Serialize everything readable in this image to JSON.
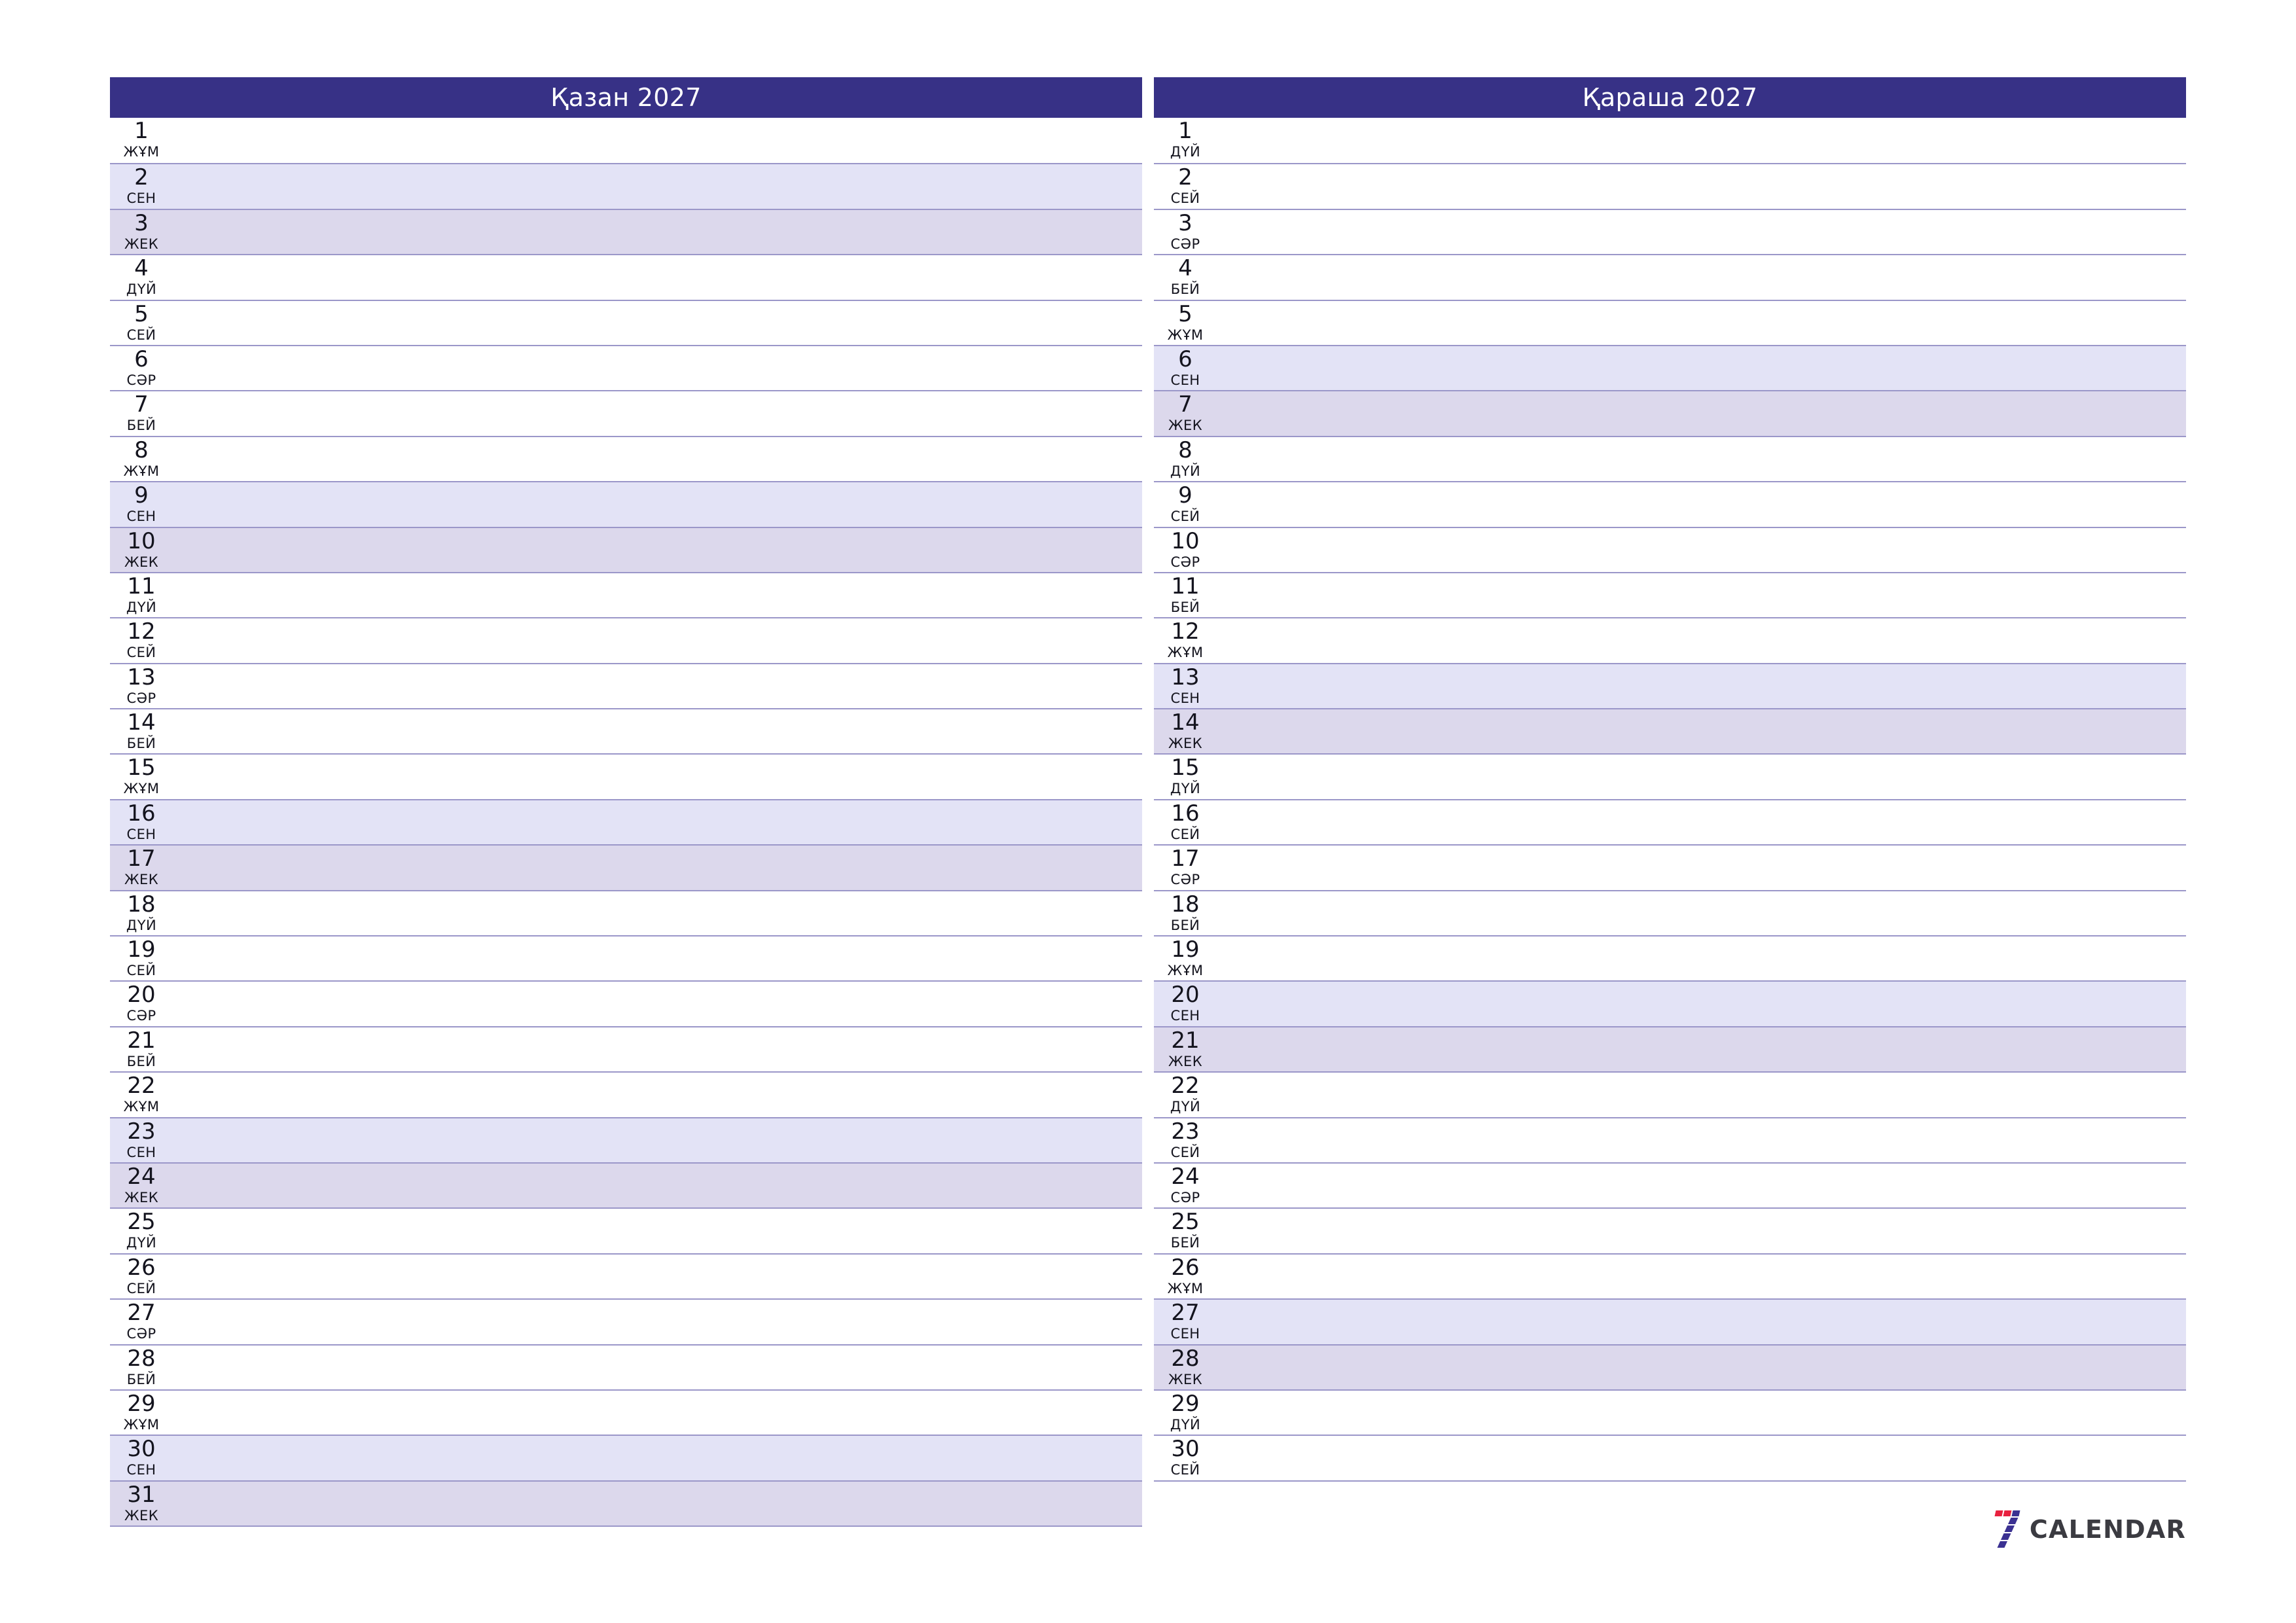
{
  "document": {
    "type": "monthly-planner",
    "year": "2027",
    "orientation": "landscape"
  },
  "colors": {
    "header_bg": "#373186",
    "header_text": "#ffffff",
    "saturday_bg": "#e3e3f6",
    "sunday_bg": "#dcd8ec",
    "grid_line": "#9b97c9",
    "day_text": "#14141e",
    "logo_red": "#e8213f",
    "logo_navy": "#3b3192",
    "logo_text": "#3b3b41"
  },
  "weekday_abbr": {
    "mon": "ДҮЙ",
    "tue": "СЕЙ",
    "wed": "СӘР",
    "thu": "БЕЙ",
    "fri": "ЖҰМ",
    "sat": "СЕН",
    "sun": "ЖЕК"
  },
  "months": [
    {
      "id": "october",
      "title": "Қазан 2027",
      "days": [
        {
          "num": "1",
          "wd": "ЖҰМ",
          "type": "weekday"
        },
        {
          "num": "2",
          "wd": "СЕН",
          "type": "sat"
        },
        {
          "num": "3",
          "wd": "ЖЕК",
          "type": "sun"
        },
        {
          "num": "4",
          "wd": "ДҮЙ",
          "type": "weekday"
        },
        {
          "num": "5",
          "wd": "СЕЙ",
          "type": "weekday"
        },
        {
          "num": "6",
          "wd": "СӘР",
          "type": "weekday"
        },
        {
          "num": "7",
          "wd": "БЕЙ",
          "type": "weekday"
        },
        {
          "num": "8",
          "wd": "ЖҰМ",
          "type": "weekday"
        },
        {
          "num": "9",
          "wd": "СЕН",
          "type": "sat"
        },
        {
          "num": "10",
          "wd": "ЖЕК",
          "type": "sun"
        },
        {
          "num": "11",
          "wd": "ДҮЙ",
          "type": "weekday"
        },
        {
          "num": "12",
          "wd": "СЕЙ",
          "type": "weekday"
        },
        {
          "num": "13",
          "wd": "СӘР",
          "type": "weekday"
        },
        {
          "num": "14",
          "wd": "БЕЙ",
          "type": "weekday"
        },
        {
          "num": "15",
          "wd": "ЖҰМ",
          "type": "weekday"
        },
        {
          "num": "16",
          "wd": "СЕН",
          "type": "sat"
        },
        {
          "num": "17",
          "wd": "ЖЕК",
          "type": "sun"
        },
        {
          "num": "18",
          "wd": "ДҮЙ",
          "type": "weekday"
        },
        {
          "num": "19",
          "wd": "СЕЙ",
          "type": "weekday"
        },
        {
          "num": "20",
          "wd": "СӘР",
          "type": "weekday"
        },
        {
          "num": "21",
          "wd": "БЕЙ",
          "type": "weekday"
        },
        {
          "num": "22",
          "wd": "ЖҰМ",
          "type": "weekday"
        },
        {
          "num": "23",
          "wd": "СЕН",
          "type": "sat"
        },
        {
          "num": "24",
          "wd": "ЖЕК",
          "type": "sun"
        },
        {
          "num": "25",
          "wd": "ДҮЙ",
          "type": "weekday"
        },
        {
          "num": "26",
          "wd": "СЕЙ",
          "type": "weekday"
        },
        {
          "num": "27",
          "wd": "СӘР",
          "type": "weekday"
        },
        {
          "num": "28",
          "wd": "БЕЙ",
          "type": "weekday"
        },
        {
          "num": "29",
          "wd": "ЖҰМ",
          "type": "weekday"
        },
        {
          "num": "30",
          "wd": "СЕН",
          "type": "sat"
        },
        {
          "num": "31",
          "wd": "ЖЕК",
          "type": "sun"
        }
      ]
    },
    {
      "id": "november",
      "title": "Қараша 2027",
      "days": [
        {
          "num": "1",
          "wd": "ДҮЙ",
          "type": "weekday"
        },
        {
          "num": "2",
          "wd": "СЕЙ",
          "type": "weekday"
        },
        {
          "num": "3",
          "wd": "СӘР",
          "type": "weekday"
        },
        {
          "num": "4",
          "wd": "БЕЙ",
          "type": "weekday"
        },
        {
          "num": "5",
          "wd": "ЖҰМ",
          "type": "weekday"
        },
        {
          "num": "6",
          "wd": "СЕН",
          "type": "sat"
        },
        {
          "num": "7",
          "wd": "ЖЕК",
          "type": "sun"
        },
        {
          "num": "8",
          "wd": "ДҮЙ",
          "type": "weekday"
        },
        {
          "num": "9",
          "wd": "СЕЙ",
          "type": "weekday"
        },
        {
          "num": "10",
          "wd": "СӘР",
          "type": "weekday"
        },
        {
          "num": "11",
          "wd": "БЕЙ",
          "type": "weekday"
        },
        {
          "num": "12",
          "wd": "ЖҰМ",
          "type": "weekday"
        },
        {
          "num": "13",
          "wd": "СЕН",
          "type": "sat"
        },
        {
          "num": "14",
          "wd": "ЖЕК",
          "type": "sun"
        },
        {
          "num": "15",
          "wd": "ДҮЙ",
          "type": "weekday"
        },
        {
          "num": "16",
          "wd": "СЕЙ",
          "type": "weekday"
        },
        {
          "num": "17",
          "wd": "СӘР",
          "type": "weekday"
        },
        {
          "num": "18",
          "wd": "БЕЙ",
          "type": "weekday"
        },
        {
          "num": "19",
          "wd": "ЖҰМ",
          "type": "weekday"
        },
        {
          "num": "20",
          "wd": "СЕН",
          "type": "sat"
        },
        {
          "num": "21",
          "wd": "ЖЕК",
          "type": "sun"
        },
        {
          "num": "22",
          "wd": "ДҮЙ",
          "type": "weekday"
        },
        {
          "num": "23",
          "wd": "СЕЙ",
          "type": "weekday"
        },
        {
          "num": "24",
          "wd": "СӘР",
          "type": "weekday"
        },
        {
          "num": "25",
          "wd": "БЕЙ",
          "type": "weekday"
        },
        {
          "num": "26",
          "wd": "ЖҰМ",
          "type": "weekday"
        },
        {
          "num": "27",
          "wd": "СЕН",
          "type": "sat"
        },
        {
          "num": "28",
          "wd": "ЖЕК",
          "type": "sun"
        },
        {
          "num": "29",
          "wd": "ДҮЙ",
          "type": "weekday"
        },
        {
          "num": "30",
          "wd": "СЕЙ",
          "type": "weekday"
        }
      ]
    }
  ],
  "logo": {
    "mark": "seven-stripes-icon",
    "text": "CALENDAR"
  }
}
